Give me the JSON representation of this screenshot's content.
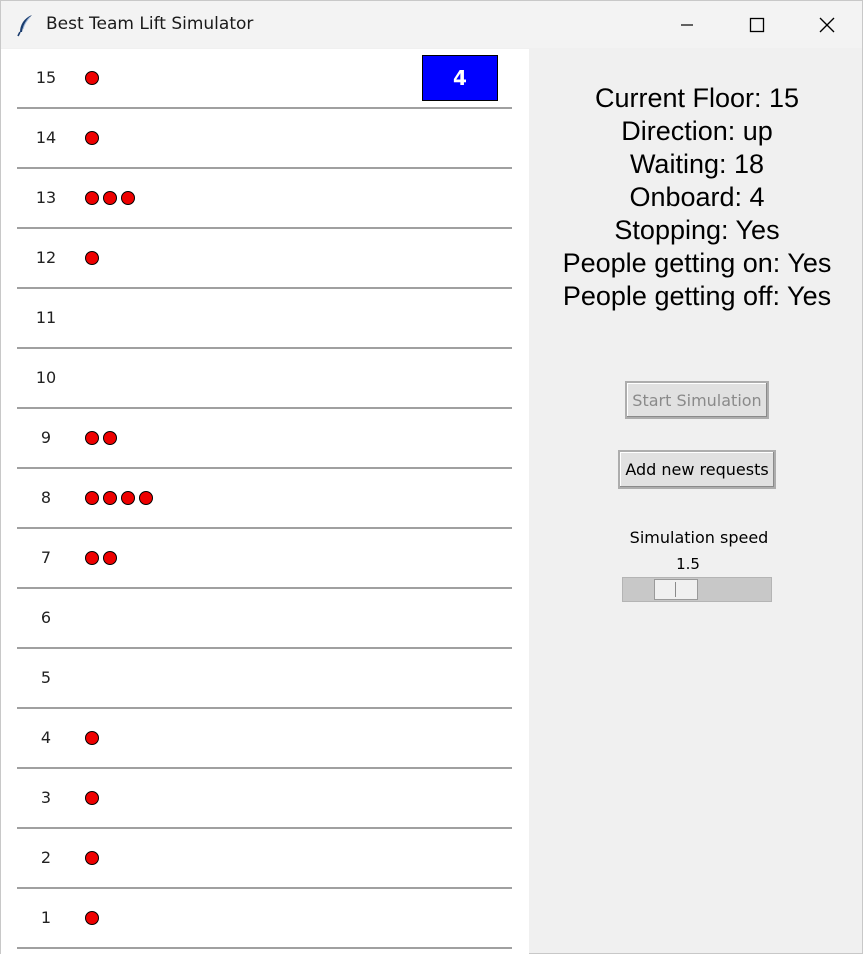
{
  "window": {
    "title": "Best Team Lift Simulator"
  },
  "building": {
    "floors": [
      {
        "number": "15",
        "waiting": 1
      },
      {
        "number": "14",
        "waiting": 1
      },
      {
        "number": "13",
        "waiting": 3
      },
      {
        "number": "12",
        "waiting": 1
      },
      {
        "number": "11",
        "waiting": 0
      },
      {
        "number": "10",
        "waiting": 0
      },
      {
        "number": "9",
        "waiting": 2
      },
      {
        "number": "8",
        "waiting": 4
      },
      {
        "number": "7",
        "waiting": 2
      },
      {
        "number": "6",
        "waiting": 0
      },
      {
        "number": "5",
        "waiting": 0
      },
      {
        "number": "4",
        "waiting": 1
      },
      {
        "number": "3",
        "waiting": 1
      },
      {
        "number": "2",
        "waiting": 1
      },
      {
        "number": "1",
        "waiting": 1
      }
    ],
    "lift": {
      "floor": "15",
      "occupants": "4",
      "color": "#0000ff"
    },
    "person_color": "#ee0000"
  },
  "status": {
    "current_floor": "Current Floor: 15",
    "direction": "Direction: up",
    "waiting": "Waiting: 18",
    "onboard": "Onboard: 4",
    "stopping": "Stopping: Yes",
    "getting_on": "People getting on: Yes",
    "getting_off": "People getting off: Yes"
  },
  "controls": {
    "start_label": "Start Simulation",
    "add_label": "Add new requests",
    "speed_label": "Simulation speed",
    "speed_value": "1.5",
    "speed_fraction": 0.3
  },
  "icons": {
    "app": "feather-icon",
    "minimize": "minimize-icon",
    "maximize": "maximize-icon",
    "close": "close-icon"
  }
}
